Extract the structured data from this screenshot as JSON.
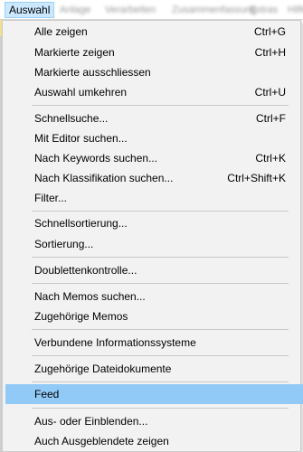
{
  "menubar": {
    "active_label": "Auswahl",
    "blurred_labels": [
      "Anlage",
      "Verarbeiten",
      "Zusammenfassung",
      "Extras",
      "Hilfe"
    ]
  },
  "menu": {
    "items": [
      {
        "label": "Alle zeigen",
        "shortcut": "Ctrl+G"
      },
      {
        "label": "Markierte zeigen",
        "shortcut": "Ctrl+H"
      },
      {
        "label": "Markierte ausschliessen",
        "shortcut": ""
      },
      {
        "label": "Auswahl umkehren",
        "shortcut": "Ctrl+U"
      },
      {
        "label": "Schnellsuche...",
        "shortcut": "Ctrl+F"
      },
      {
        "label": "Mit Editor suchen...",
        "shortcut": ""
      },
      {
        "label": "Nach Keywords suchen...",
        "shortcut": "Ctrl+K"
      },
      {
        "label": "Nach Klassifikation suchen...",
        "shortcut": "Ctrl+Shift+K"
      },
      {
        "label": "Filter...",
        "shortcut": ""
      },
      {
        "label": "Schnellsortierung...",
        "shortcut": ""
      },
      {
        "label": "Sortierung...",
        "shortcut": ""
      },
      {
        "label": "Doublettenkontrolle...",
        "shortcut": ""
      },
      {
        "label": "Nach Memos suchen...",
        "shortcut": ""
      },
      {
        "label": "Zugehörige Memos",
        "shortcut": ""
      },
      {
        "label": "Verbundene Informationssysteme",
        "shortcut": ""
      },
      {
        "label": "Zugehörige Dateidokumente",
        "shortcut": ""
      },
      {
        "label": "Feed",
        "shortcut": ""
      },
      {
        "label": "Aus- oder Einblenden...",
        "shortcut": ""
      },
      {
        "label": "Auch Ausgeblendete zeigen",
        "shortcut": ""
      }
    ],
    "highlighted_item": "Feed"
  },
  "colors": {
    "menu_background": "#f2f2f2",
    "highlight": "#91c9f7",
    "active_menubar_item": "#cce8ff"
  }
}
